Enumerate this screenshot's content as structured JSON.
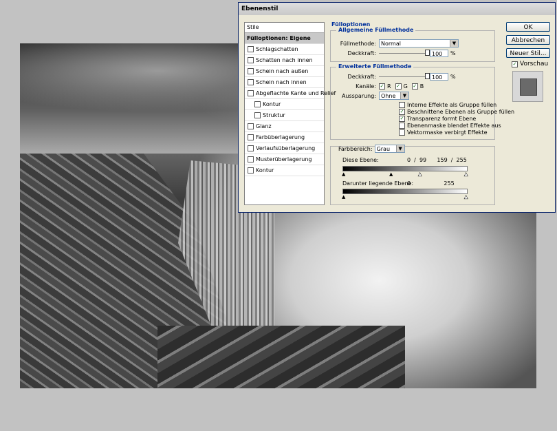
{
  "dialog": {
    "title": "Ebenenstil",
    "styles_header": "Stile",
    "styles": [
      {
        "label": "Fülloptionen: Eigene",
        "checkbox": false,
        "active": true,
        "sub": false
      },
      {
        "label": "Schlagschatten",
        "checkbox": true,
        "checked": false,
        "sub": false
      },
      {
        "label": "Schatten nach innen",
        "checkbox": true,
        "checked": false,
        "sub": false
      },
      {
        "label": "Schein nach außen",
        "checkbox": true,
        "checked": false,
        "sub": false
      },
      {
        "label": "Schein nach innen",
        "checkbox": true,
        "checked": false,
        "sub": false
      },
      {
        "label": "Abgeflachte Kante und Relief",
        "checkbox": true,
        "checked": false,
        "sub": false
      },
      {
        "label": "Kontur",
        "checkbox": true,
        "checked": false,
        "sub": true
      },
      {
        "label": "Struktur",
        "checkbox": true,
        "checked": false,
        "sub": true
      },
      {
        "label": "Glanz",
        "checkbox": true,
        "checked": false,
        "sub": false
      },
      {
        "label": "Farbüberlagerung",
        "checkbox": true,
        "checked": false,
        "sub": false
      },
      {
        "label": "Verlaufsüberlagerung",
        "checkbox": true,
        "checked": false,
        "sub": false
      },
      {
        "label": "Musterüberlagerung",
        "checkbox": true,
        "checked": false,
        "sub": false
      },
      {
        "label": "Kontur",
        "checkbox": true,
        "checked": false,
        "sub": false
      }
    ],
    "panel": {
      "title": "Fülloptionen",
      "general": {
        "legend": "Allgemeine Füllmethode",
        "mode_label": "Füllmethode:",
        "mode_value": "Normal",
        "opacity_label": "Deckkraft:",
        "opacity_value": "100",
        "opacity_level": 1.0,
        "percent": "%"
      },
      "advanced": {
        "legend": "Erweiterte Füllmethode",
        "fill_label": "Deckkraft:",
        "fill_value": "100",
        "fill_level": 1.0,
        "percent": "%",
        "channels_label": "Kanäle:",
        "channels": [
          {
            "label": "R",
            "checked": true
          },
          {
            "label": "G",
            "checked": true
          },
          {
            "label": "B",
            "checked": true
          }
        ],
        "knockout_label": "Aussparung:",
        "knockout_value": "Ohne",
        "options": [
          {
            "label": "Interne Effekte als Gruppe füllen",
            "checked": false
          },
          {
            "label": "Beschnittene Ebenen als Gruppe füllen",
            "checked": true
          },
          {
            "label": "Transparenz formt Ebene",
            "checked": true
          },
          {
            "label": "Ebenenmaske blendet Effekte aus",
            "checked": false
          },
          {
            "label": "Vektormaske verbirgt Effekte",
            "checked": false
          }
        ]
      },
      "blendif": {
        "label": "Farbbereich:",
        "value": "Grau",
        "this_layer_label": "Diese Ebene:",
        "this_layer_values": "0  /  99      159  /  255",
        "underlying_label": "Darunter liegende Ebene:",
        "underlying_values": "0                   255"
      }
    },
    "buttons": {
      "ok": "OK",
      "cancel": "Abbrechen",
      "new_style": "Neuer Stil..."
    },
    "preview_label": "Vorschau",
    "preview_checked": true
  }
}
